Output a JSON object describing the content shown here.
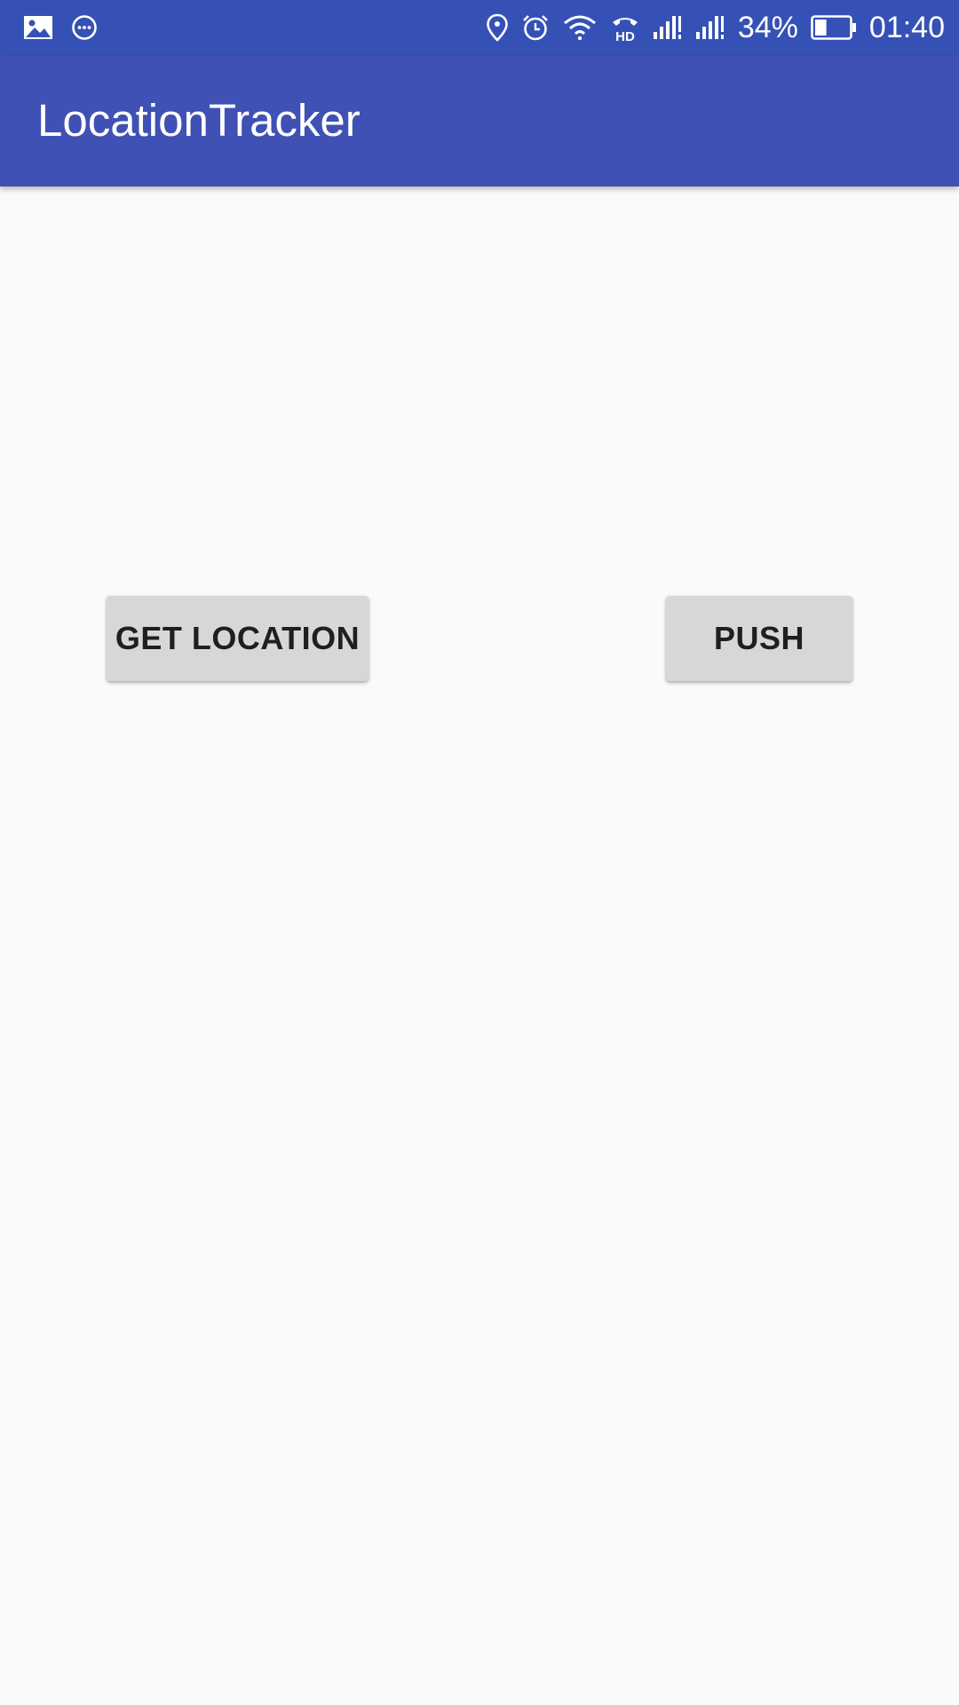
{
  "status_bar": {
    "left_icons": [
      "image-icon",
      "chat-bubble-icon"
    ],
    "right_icons": [
      "location-icon",
      "alarm-icon",
      "wifi-icon",
      "hd-call-icon",
      "signal-icon",
      "signal-icon"
    ],
    "battery_percent": "34%",
    "battery_level": 0.34,
    "time": "01:40"
  },
  "app_bar": {
    "title": "LocationTracker",
    "color": "#3f51b5"
  },
  "main": {
    "get_location_label": "GET LOCATION",
    "push_label": "PUSH"
  },
  "colors": {
    "status_bar": "#3651b6",
    "background": "#fafafa",
    "button": "#d6d7d7"
  }
}
